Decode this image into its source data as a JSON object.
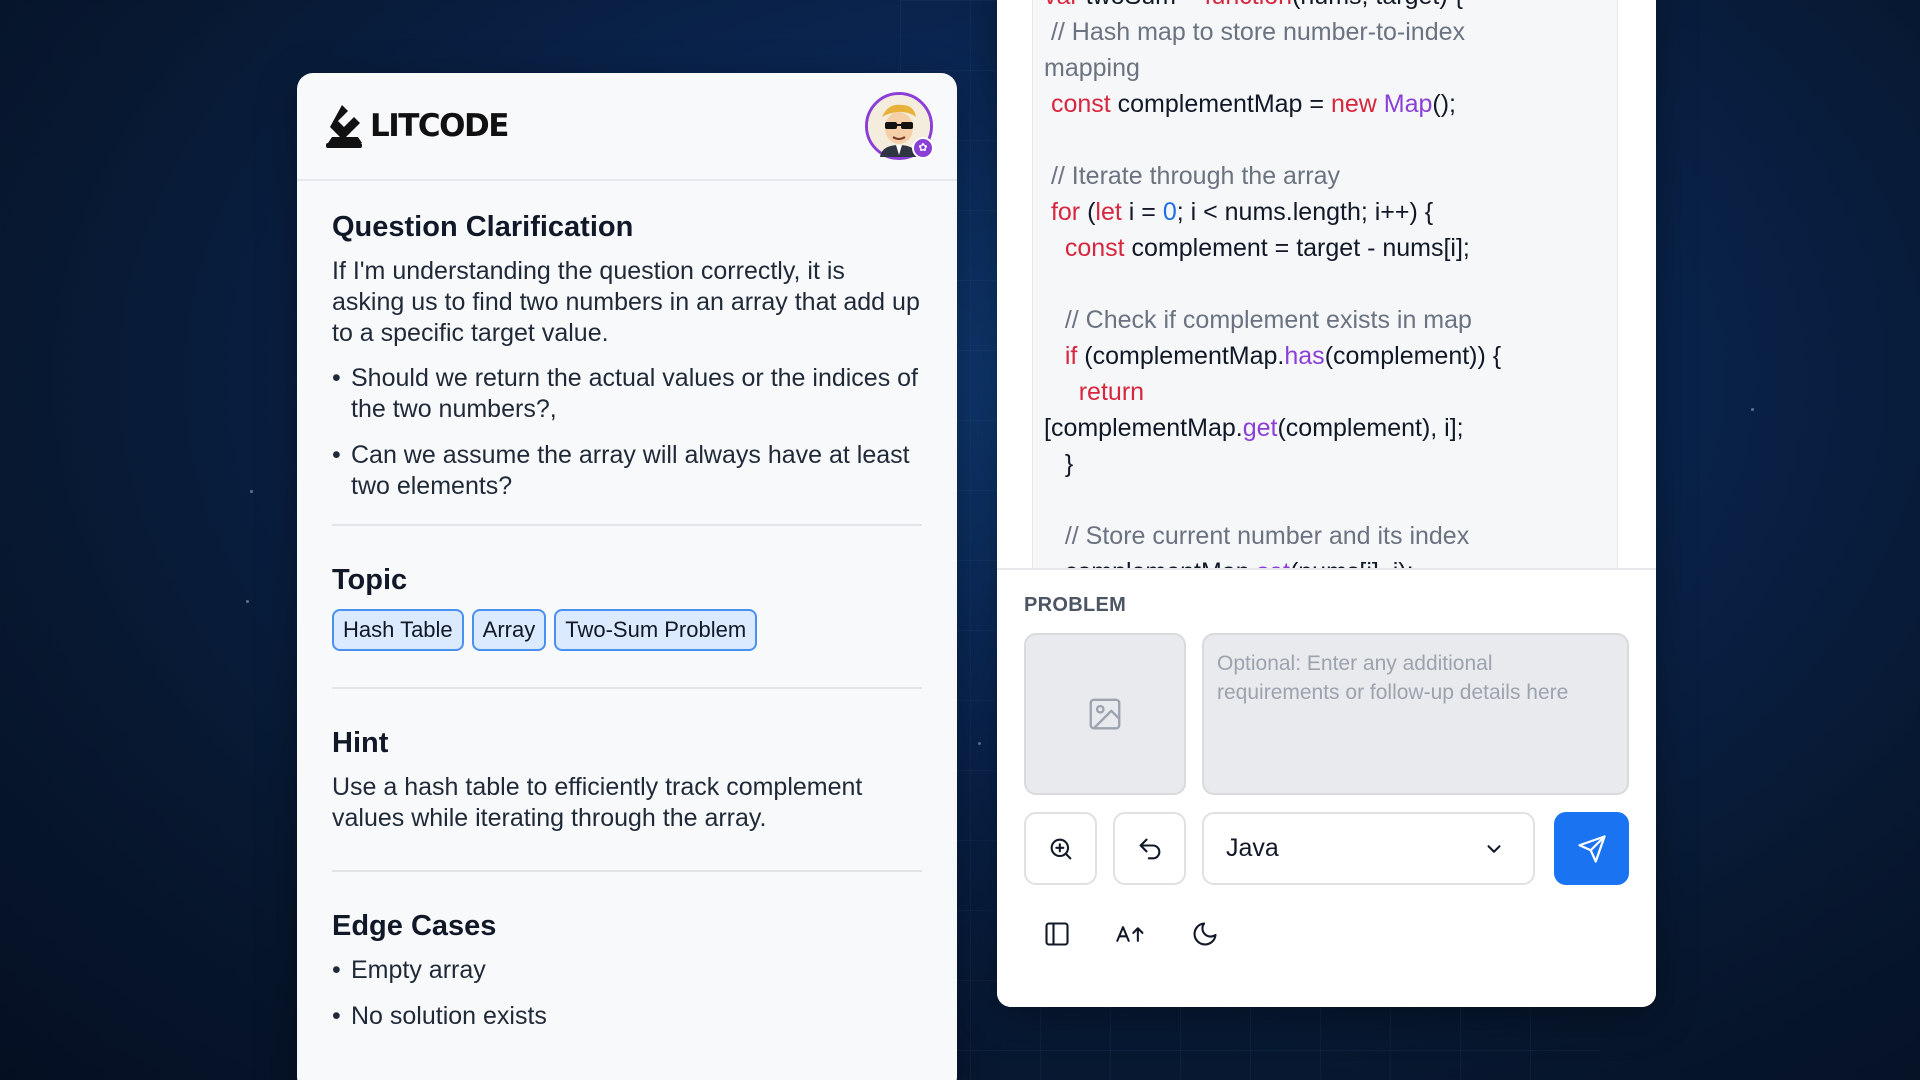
{
  "brand": {
    "name": "LITCODE"
  },
  "avatar": {
    "alt": "user-avatar"
  },
  "clarification": {
    "title": "Question Clarification",
    "text": "If I'm understanding the question correctly, it is asking us to find two numbers in an array that add up to a specific target value.",
    "bullets": [
      "Should we return the actual values or the indices of the two numbers?,",
      "Can we assume the array will always have at least two elements?"
    ]
  },
  "topic": {
    "title": "Topic",
    "tags": [
      "Hash Table",
      "Array",
      "Two-Sum Problem"
    ]
  },
  "hint": {
    "title": "Hint",
    "text": "Use a hash table to efficiently track complement values while iterating through the array."
  },
  "edge_cases": {
    "title": "Edge Cases",
    "bullets": [
      "Empty array",
      "No solution exists"
    ]
  },
  "code": {
    "lines": [
      [
        [
          "kw",
          "var "
        ],
        [
          "txt",
          "twoSum = "
        ],
        [
          "kw",
          "function"
        ],
        [
          "txt",
          "(nums, target) {"
        ]
      ],
      [
        [
          "cm",
          " // Hash map to store number-to-index"
        ]
      ],
      [
        [
          "cm",
          "mapping"
        ]
      ],
      [
        [
          "txt",
          " "
        ],
        [
          "kw",
          "const "
        ],
        [
          "txt",
          "complementMap = "
        ],
        [
          "kw",
          "new "
        ],
        [
          "fn",
          "Map"
        ],
        [
          "txt",
          "();"
        ]
      ],
      [
        [
          "txt",
          ""
        ]
      ],
      [
        [
          "cm",
          " // Iterate through the array"
        ]
      ],
      [
        [
          "txt",
          " "
        ],
        [
          "kw",
          "for "
        ],
        [
          "txt",
          "("
        ],
        [
          "kw",
          "let "
        ],
        [
          "txt",
          "i = "
        ],
        [
          "num",
          "0"
        ],
        [
          "txt",
          "; i < nums.length; i++) {"
        ]
      ],
      [
        [
          "txt",
          "   "
        ],
        [
          "kw",
          "const "
        ],
        [
          "txt",
          "complement = target - nums[i];"
        ]
      ],
      [
        [
          "txt",
          ""
        ]
      ],
      [
        [
          "cm",
          "   // Check if complement exists in map"
        ]
      ],
      [
        [
          "txt",
          "   "
        ],
        [
          "kw",
          "if "
        ],
        [
          "txt",
          "(complementMap."
        ],
        [
          "fn",
          "has"
        ],
        [
          "txt",
          "(complement)) {"
        ]
      ],
      [
        [
          "txt",
          "     "
        ],
        [
          "kw",
          "return"
        ]
      ],
      [
        [
          "txt",
          "[complementMap."
        ],
        [
          "fn",
          "get"
        ],
        [
          "txt",
          "(complement), i];"
        ]
      ],
      [
        [
          "txt",
          "   }"
        ]
      ],
      [
        [
          "txt",
          ""
        ]
      ],
      [
        [
          "cm",
          "   // Store current number and its index"
        ]
      ],
      [
        [
          "txt",
          "   complementMap."
        ],
        [
          "fn",
          "set"
        ],
        [
          "txt",
          "(nums[i], i);"
        ]
      ]
    ]
  },
  "problem": {
    "label": "PROBLEM",
    "placeholder": "Optional: Enter any additional requirements or follow-up details here",
    "language": "Java"
  },
  "icons": {
    "image": "image-icon",
    "zoom": "zoom-in-icon",
    "undo": "undo-icon",
    "chevron": "chevron-down-icon",
    "send": "send-icon",
    "sidebar": "sidebar-toggle-icon",
    "font": "font-size-icon",
    "theme": "moon-icon"
  },
  "colors": {
    "accent": "#1a73f0",
    "avatar_ring": "#8b3fd6",
    "tag_bg": "#dbeafe",
    "tag_border": "#4a90f0",
    "keyword": "#d7263d",
    "function": "#8b3fd6",
    "number": "#1d6fe6",
    "comment": "#6b7280"
  }
}
